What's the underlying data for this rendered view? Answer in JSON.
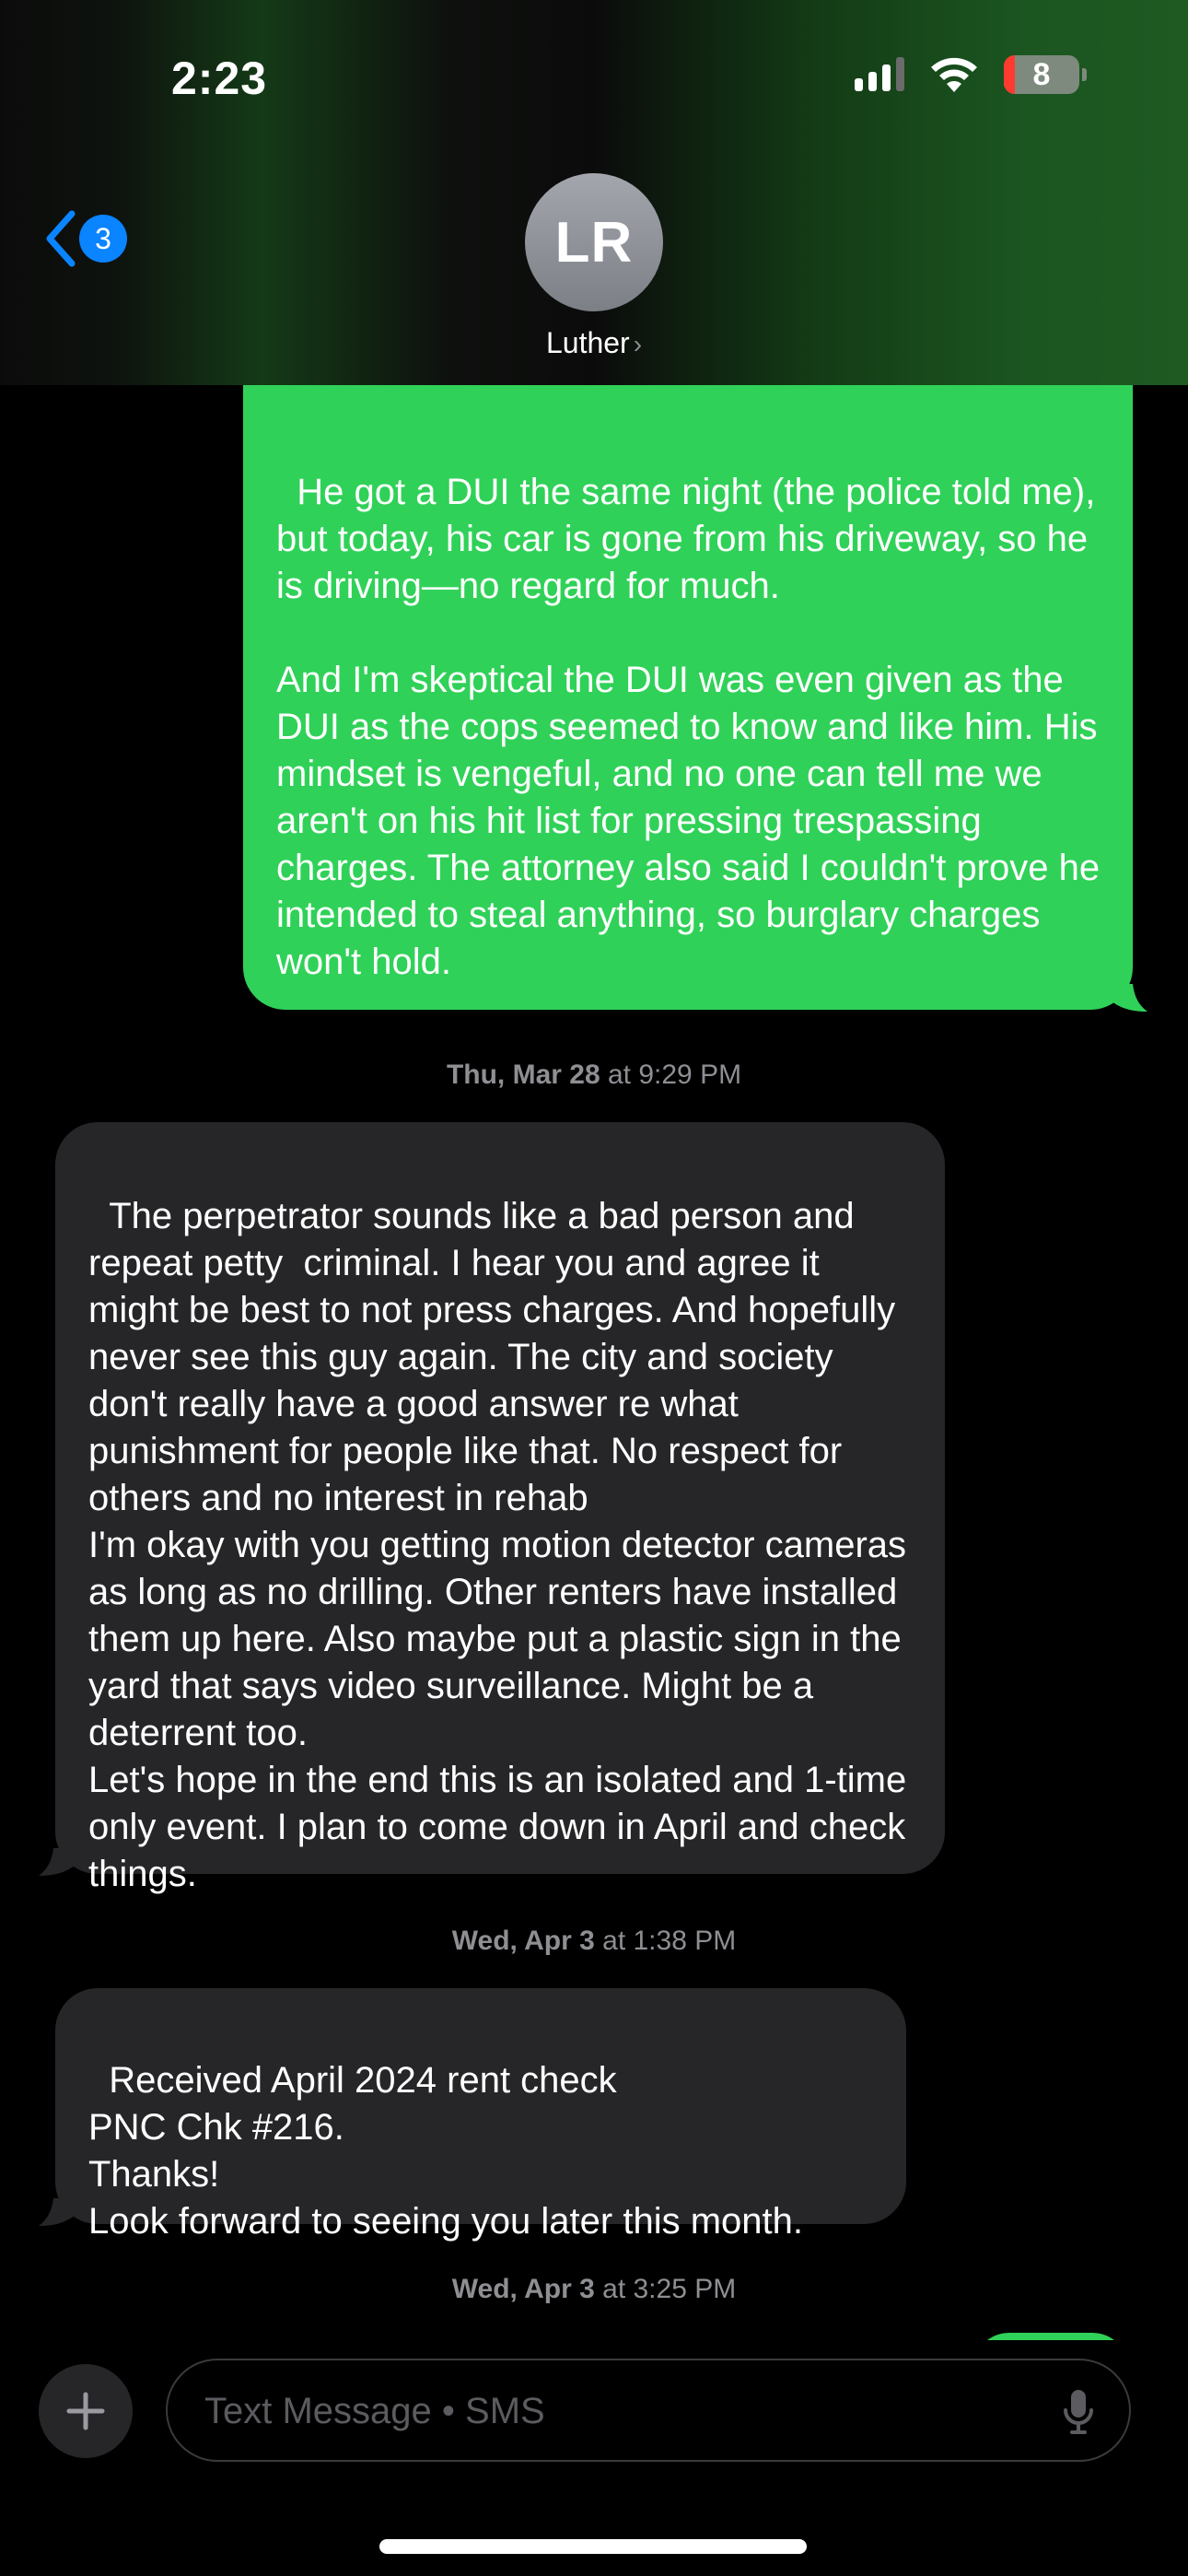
{
  "status_bar": {
    "time": "2:23",
    "battery_level": "8"
  },
  "header": {
    "back_count": "3",
    "avatar_initials": "LR",
    "contact_name": "Luther",
    "chevron": "›"
  },
  "messages": [
    {
      "direction": "sent",
      "text": "He got a DUI the same night (the police told me), but today, his car is gone from his driveway, so he is driving—no regard for much.\n\nAnd I'm skeptical the DUI was even given as the DUI as the cops seemed to know and like him. His mindset is vengeful, and no one can tell me we aren't on his hit list for pressing trespassing charges. The attorney also said I couldn't prove he intended to steal anything, so burglary charges won't hold."
    },
    {
      "timestamp_day": "Thu, Mar 28",
      "timestamp_time": "at 9:29 PM"
    },
    {
      "direction": "received",
      "text": "The perpetrator sounds like a bad person and repeat petty  criminal. I hear you and agree it might be best to not press charges. And hopefully never see this guy again. The city and society don't really have a good answer re what punishment for people like that. No respect for others and no interest in rehab\nI'm okay with you getting motion detector cameras as long as no drilling. Other renters have installed them up here. Also maybe put a plastic sign in the yard that says video surveillance. Might be a deterrent too.\nLet's hope in the end this is an isolated and 1-time only event. I plan to come down in April and check things."
    },
    {
      "timestamp_day": "Wed, Apr 3",
      "timestamp_time": "at 1:38 PM"
    },
    {
      "direction": "received",
      "text": "Received April 2024 rent check\nPNC Chk #216.\nThanks!\nLook forward to seeing you later this month."
    },
    {
      "timestamp_day": "Wed, Apr 3",
      "timestamp_time": "at 3:25 PM"
    }
  ],
  "composer": {
    "placeholder": "Text Message • SMS",
    "value": ""
  },
  "icons": {
    "back": "chevron-left-icon",
    "plus": "plus-icon",
    "mic": "microphone-icon",
    "wifi": "wifi-icon",
    "signal": "cellular-signal-icon",
    "battery": "battery-icon"
  },
  "colors": {
    "sent_bubble": "#30d158",
    "received_bubble": "#262628",
    "accent": "#0a84ff",
    "timestamp": "#8e8e93"
  }
}
